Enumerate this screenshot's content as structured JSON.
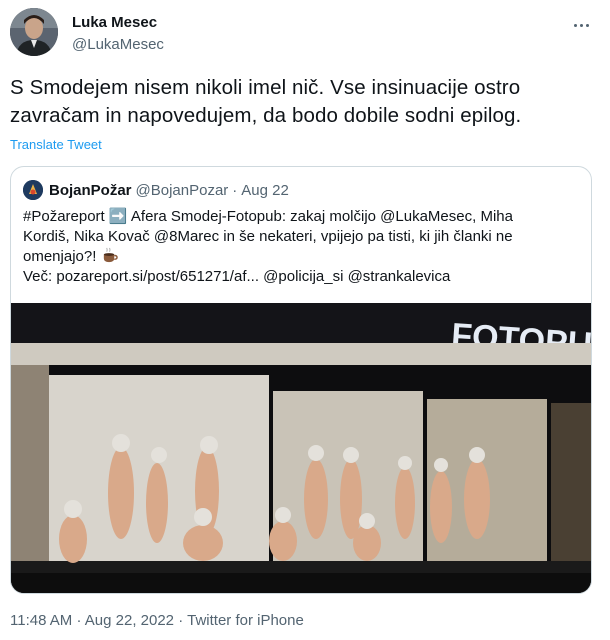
{
  "tweet": {
    "author_name": "Luka Mesec",
    "author_handle": "@LukaMesec",
    "more_icon": "more-dots-icon",
    "text_lines": [
      "S Smodejem nisem nikoli imel nič. Vse insinuacije ostro",
      "zavračam in napovedujem, da bodo dobile sodni epilog."
    ],
    "translate_label": "Translate Tweet",
    "timestamp": "11:48 AM",
    "date": "Aug 22, 2022",
    "source": "Twitter for iPhone"
  },
  "quoted": {
    "author_name": "BojanPožar",
    "author_handle": "@BojanPozar",
    "date": "Aug 22",
    "lines": [
      "#Požareport ➡️ Afera Smodej-Fotopub: zakaj molčijo @LukaMesec, Miha",
      "Kordiš, Nika Kovač @8Marec in še nekateri, vpijejo pa tisti, ki jih članki ne",
      "omenjajo?!",
      "Več: pozareport.si/post/651271/af... @policija_si @strankalevica"
    ],
    "image_sign": "FOTOPUB"
  },
  "colors": {
    "link": "#1d9bf0",
    "secondary_text": "#536471",
    "border": "#cfd9de"
  }
}
